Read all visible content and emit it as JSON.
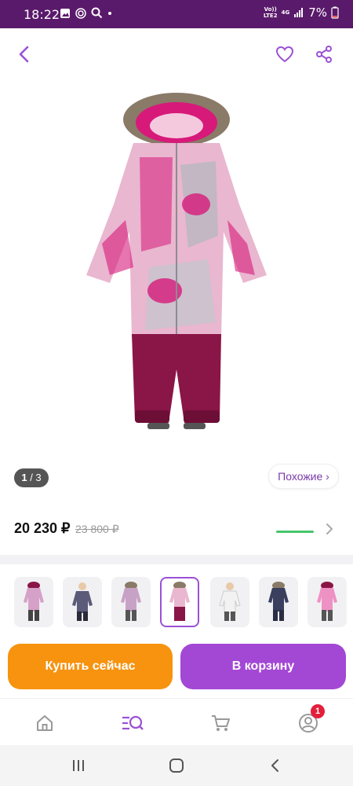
{
  "status_bar": {
    "time": "18:22",
    "network_top": "Vo))",
    "network_bottom": "LTE2",
    "net_type": "4G",
    "battery": "7%"
  },
  "top_bar": {
    "back_icon": "chevron-left-icon",
    "favorite_icon": "heart-icon",
    "share_icon": "share-icon"
  },
  "product": {
    "image_alt": "pink winter overall",
    "page_index": "1",
    "page_total": "/ 3",
    "similar_label": "Похожие ›"
  },
  "price": {
    "current": "20 230 ₽",
    "old": "23 800 ₽"
  },
  "thumbnails": [
    {
      "color": "#d6a1c9",
      "selected": false
    },
    {
      "color": "#5b5a79",
      "selected": false
    },
    {
      "color": "#c8a2c6",
      "selected": false
    },
    {
      "color": "#c0325f",
      "selected": true
    },
    {
      "color": "#e5e5e5",
      "selected": false
    },
    {
      "color": "#3a3f5e",
      "selected": false
    },
    {
      "color": "#ee92c5",
      "selected": false
    }
  ],
  "actions": {
    "buy_now": "Купить сейчас",
    "add_to_cart": "В корзину"
  },
  "bottom_nav": {
    "items": [
      "home-icon",
      "catalog-search-icon",
      "cart-icon",
      "profile-icon"
    ],
    "badge_count": "1"
  },
  "colors": {
    "status_bar": "#5a1a6b",
    "accent": "#a347d5",
    "buy": "#f7930f"
  }
}
